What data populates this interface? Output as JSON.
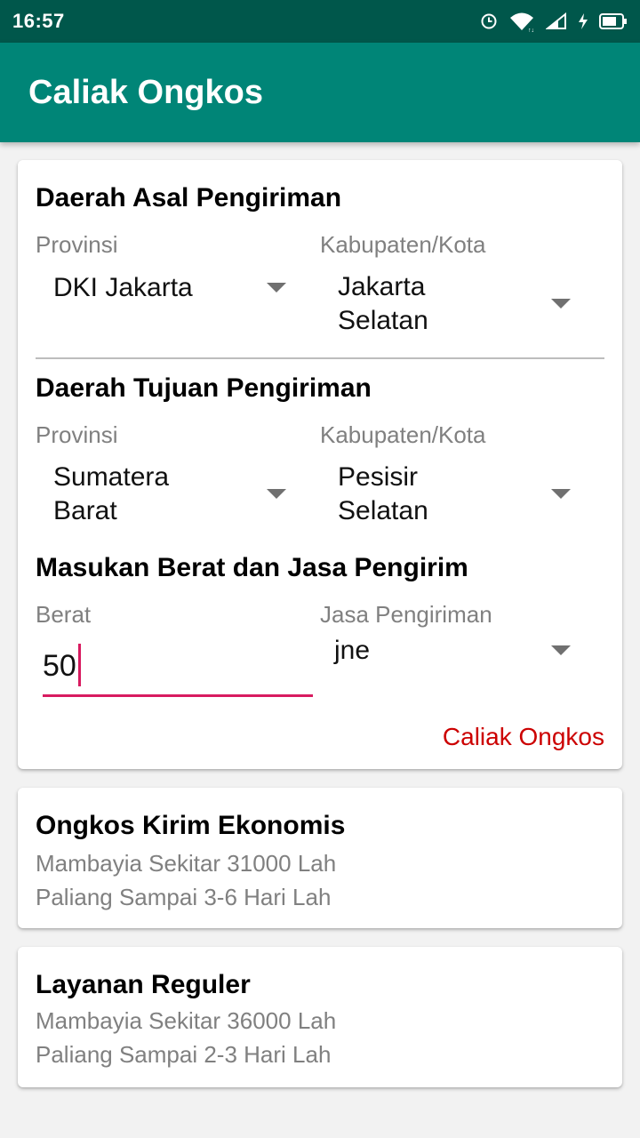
{
  "status_bar": {
    "time": "16:57",
    "icons": [
      "alarm-icon",
      "wifi-icon",
      "signal-icon",
      "charging-icon",
      "battery-icon"
    ]
  },
  "app_bar": {
    "title": "Caliak Ongkos",
    "color": "#008577"
  },
  "origin": {
    "title": "Daerah Asal Pengiriman",
    "province_label": "Provinsi",
    "province_value": "DKI Jakarta",
    "city_label": "Kabupaten/Kota",
    "city_value_line1": "Jakarta",
    "city_value_line2": "Selatan"
  },
  "destination": {
    "title": "Daerah Tujuan Pengiriman",
    "province_label": "Provinsi",
    "province_value_line1": "Sumatera",
    "province_value_line2": "Barat",
    "city_label": "Kabupaten/Kota",
    "city_value_line1": "Pesisir",
    "city_value_line2": "Selatan"
  },
  "weight_courier": {
    "title": "Masukan Berat dan Jasa Pengirim",
    "weight_label": "Berat",
    "weight_value": "50",
    "courier_label": "Jasa Pengiriman",
    "courier_value": "jne"
  },
  "action": {
    "label": "Caliak Ongkos",
    "color": "#cc0000"
  },
  "results": [
    {
      "title": "Ongkos Kirim Ekonomis",
      "cost": "Mambayia Sekitar 31000 Lah",
      "duration": "Paliang Sampai 3-6 Hari Lah"
    },
    {
      "title": "Layanan Reguler",
      "cost": "Mambayia Sekitar 36000 Lah",
      "duration": "Paliang Sampai 2-3 Hari Lah"
    }
  ]
}
